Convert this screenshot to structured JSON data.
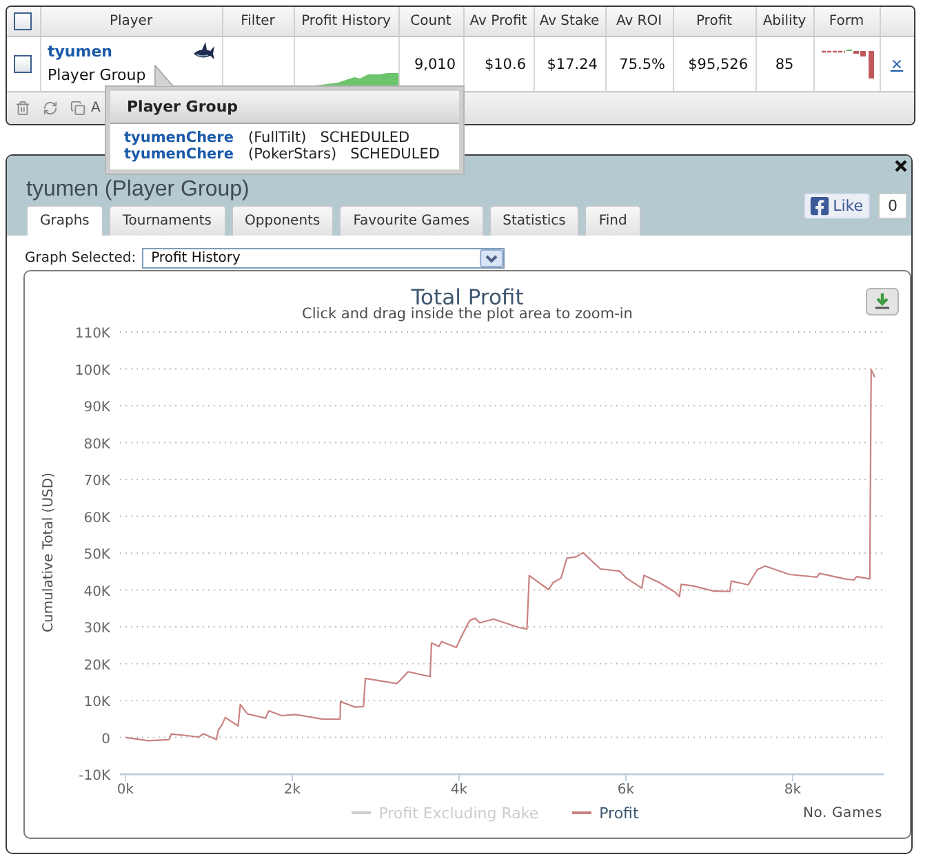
{
  "players_table": {
    "select_all": {
      "checked": false
    },
    "columns": [
      "Player",
      "Filter",
      "Profit History",
      "Count",
      "Av Profit",
      "Av Stake",
      "Av ROI",
      "Profit",
      "Ability",
      "Form"
    ],
    "rows": [
      {
        "checked": false,
        "player": "tyumen",
        "group": "Player Group",
        "count": "9,010",
        "av_profit": "$10.6",
        "av_stake": "$17.24",
        "av_roi": "75.5%",
        "profit": "$95,526",
        "ability": "85",
        "remove": "×"
      }
    ],
    "toolbar_text": "A"
  },
  "tooltip": {
    "title": "Player Group",
    "accounts": [
      {
        "name": "tyumenChere",
        "site": "(FullTilt)",
        "status": "SCHEDULED"
      },
      {
        "name": "tyumenChere",
        "site": "(PokerStars)",
        "status": "SCHEDULED"
      }
    ]
  },
  "panel": {
    "title": "tyumen (Player Group)",
    "like": {
      "label": "Like",
      "count": "0"
    },
    "tabs": [
      {
        "label": "Graphs",
        "selected": true
      },
      {
        "label": "Tournaments",
        "selected": false
      },
      {
        "label": "Opponents",
        "selected": false
      },
      {
        "label": "Favourite Games",
        "selected": false
      },
      {
        "label": "Statistics",
        "selected": false
      },
      {
        "label": "Find",
        "selected": false
      }
    ],
    "graph_select": {
      "label": "Graph Selected:",
      "value": "Profit History"
    },
    "chart": {
      "subtitle": "Click and drag inside the plot area to zoom-in",
      "legend": [
        {
          "enabled": false
        },
        {
          "enabled": true
        }
      ],
      "chart_data": {
        "type": "line",
        "title": "Total Profit",
        "xlabel": "No. Games",
        "ylabel": "Cumulative Total (USD)",
        "grid": true,
        "x": [
          0,
          275,
          523,
          551,
          881,
          936,
          1091,
          1113,
          1157,
          1196,
          1350,
          1377,
          1460,
          1680,
          1719,
          1873,
          2039,
          2369,
          2573,
          2579,
          2755,
          2854,
          2876,
          3251,
          3295,
          3388,
          3653,
          3669,
          3758,
          3791,
          3967,
          4011,
          4105,
          4132,
          4193,
          4248,
          4413,
          4715,
          4814,
          4842,
          5073,
          5128,
          5221,
          5293,
          5403,
          5486,
          5695,
          5926,
          6008,
          6190,
          6217,
          6393,
          6586,
          6641,
          6663,
          6806,
          7053,
          7246,
          7263,
          7466,
          7576,
          7669,
          7961,
          8292,
          8319,
          8622,
          8732,
          8765,
          8924,
          8940,
          8985
        ],
        "series": [
          {
            "name": "Profit Excluding Rake",
            "color": "#cccccc",
            "values": [
              null,
              null,
              null,
              null,
              null,
              null,
              null,
              null,
              null,
              null,
              null,
              null,
              null,
              null,
              null,
              null,
              null,
              null,
              null,
              null,
              null,
              null,
              null,
              null,
              null,
              null,
              null,
              null,
              null,
              null,
              null,
              null,
              null,
              null,
              null,
              null,
              null,
              null,
              null,
              null,
              null,
              null,
              null,
              null,
              null,
              null,
              null,
              null,
              null,
              null,
              null,
              null,
              null,
              null,
              null,
              null,
              null,
              null,
              null,
              null,
              null,
              null,
              null,
              null,
              null,
              null,
              null,
              null,
              null,
              null,
              null
            ]
          },
          {
            "name": "Profit",
            "color": "#c98181",
            "values": [
              0,
              -900,
              -600,
              900,
              100,
              1000,
              -600,
              1900,
              3400,
              5400,
              3100,
              8900,
              6400,
              5200,
              7200,
              5900,
              6200,
              4900,
              5000,
              9700,
              8200,
              8400,
              16000,
              14600,
              15500,
              17800,
              16500,
              25600,
              24700,
              26000,
              24400,
              26600,
              30800,
              31800,
              32300,
              31100,
              32100,
              29800,
              29400,
              43900,
              40100,
              42000,
              43200,
              48600,
              49000,
              50100,
              45700,
              45100,
              43200,
              40500,
              44000,
              42100,
              39500,
              38200,
              41500,
              41100,
              39700,
              39600,
              42400,
              41400,
              45500,
              46500,
              44200,
              43500,
              44500,
              43000,
              42700,
              43600,
              43000,
              99800,
              97700
            ]
          }
        ],
        "xlim": [
          -66,
          9091
        ],
        "ylim": [
          -10000,
          110000
        ],
        "xticks": [
          {
            "value": 0,
            "label": "0k"
          },
          {
            "value": 2000,
            "label": "2k"
          },
          {
            "value": 4000,
            "label": "4k"
          },
          {
            "value": 6000,
            "label": "6k"
          },
          {
            "value": 8000,
            "label": "8k"
          }
        ],
        "yticks": [
          {
            "value": -10000,
            "label": "-10K"
          },
          0,
          {
            "value": 10000,
            "label": "10K"
          },
          {
            "value": 20000,
            "label": "20K"
          },
          {
            "value": 30000,
            "label": "30K"
          },
          {
            "value": 40000,
            "label": "40K"
          },
          {
            "value": 50000,
            "label": "50K"
          },
          {
            "value": 60000,
            "label": "60K"
          },
          {
            "value": 70000,
            "label": "70K"
          },
          {
            "value": 80000,
            "label": "80K"
          },
          {
            "value": 90000,
            "label": "90K"
          },
          {
            "value": 100000,
            "label": "100K"
          },
          {
            "value": 110000,
            "label": "110K"
          }
        ]
      }
    }
  }
}
